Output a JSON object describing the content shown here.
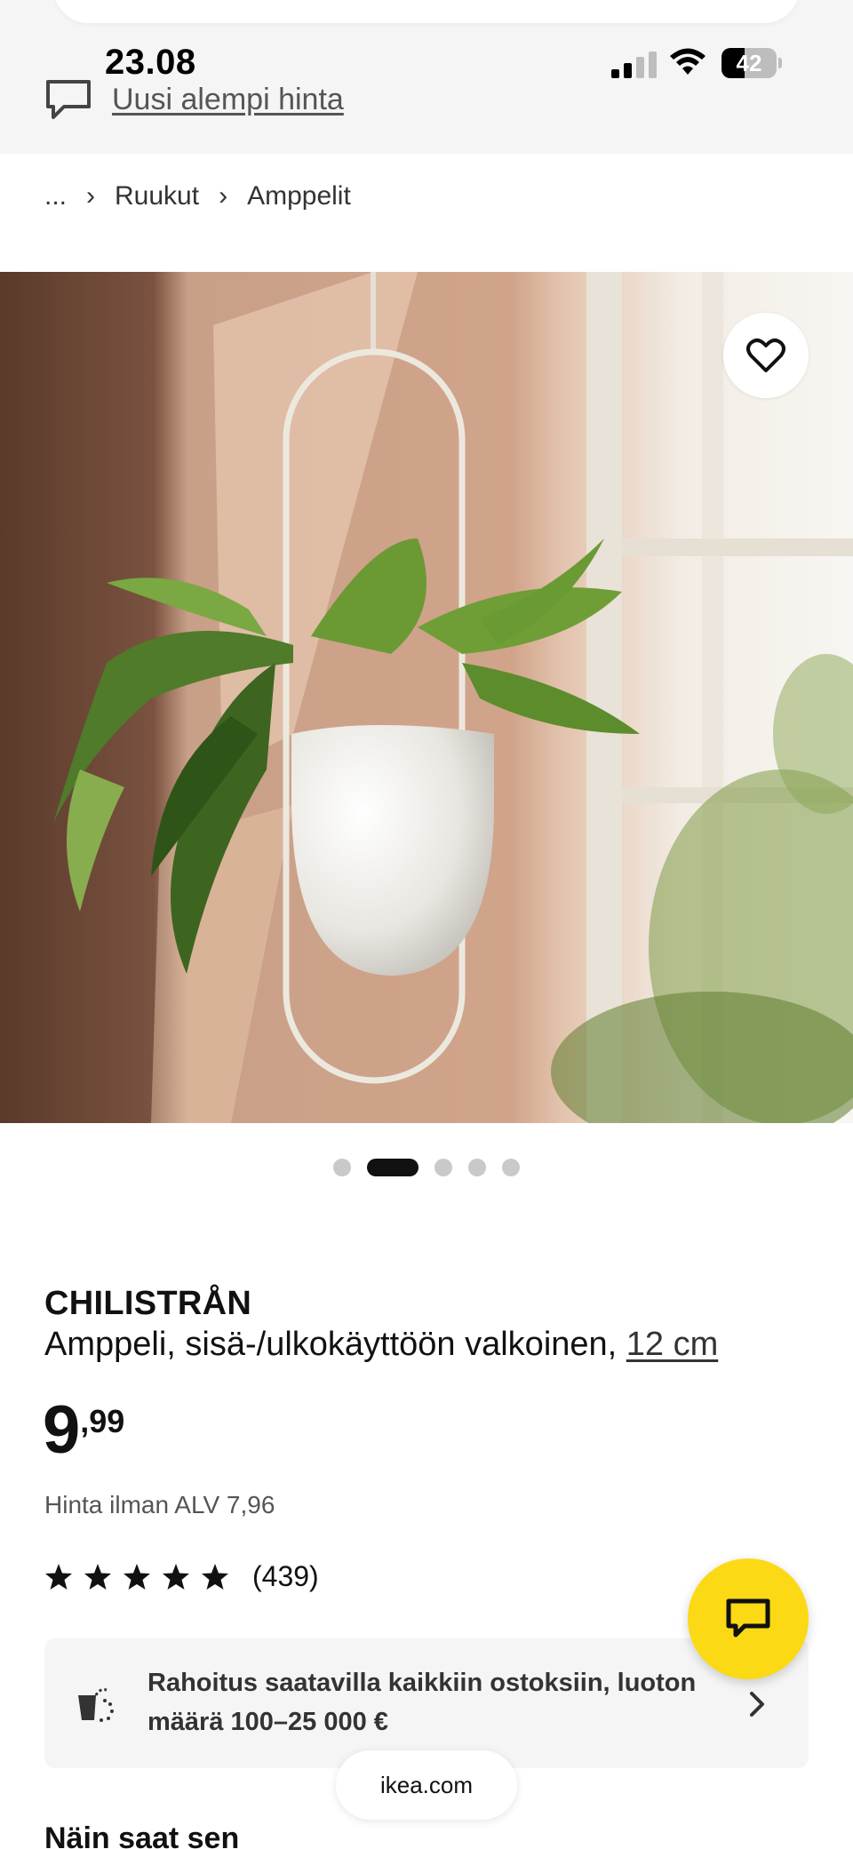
{
  "status_bar": {
    "time": "23.08",
    "battery_percent": "42",
    "battery_level": 0.42,
    "signal_bars_active": 2,
    "signal_bars_total": 4
  },
  "top_bar": {
    "link_label": "Uusi alempi hinta",
    "link_icon": "chat-bubble-icon"
  },
  "breadcrumb": {
    "items": [
      "...",
      "Ruukut",
      "Amppelit"
    ],
    "separator_icon": "chevron-right-icon"
  },
  "gallery": {
    "favorite_icon": "heart-icon",
    "image_count": 5,
    "active_index": 1
  },
  "product": {
    "name": "CHILISTRÅN",
    "description": "Amppeli, sisä-/ulkokäyttöön valkoinen, ",
    "size": "12 cm",
    "price_integer": "9",
    "price_decimal": ",99",
    "vat_note": "Hinta ilman ALV 7,96",
    "rating_stars": 5,
    "review_count": "(439)"
  },
  "financing": {
    "text": "Rahoitus saatavilla kaikkiin ostoksiin, luoton määrä 100–25 000 €",
    "icon": "credit-cart-icon",
    "chevron_icon": "chevron-right-icon"
  },
  "chat_button": {
    "icon": "chat-icon"
  },
  "browser": {
    "url": "ikea.com"
  },
  "next_section": {
    "heading": "Näin saat sen"
  },
  "colors": {
    "accent_yellow": "#fbd914",
    "text_dark": "#111111",
    "panel_gray": "#f5f5f5"
  }
}
